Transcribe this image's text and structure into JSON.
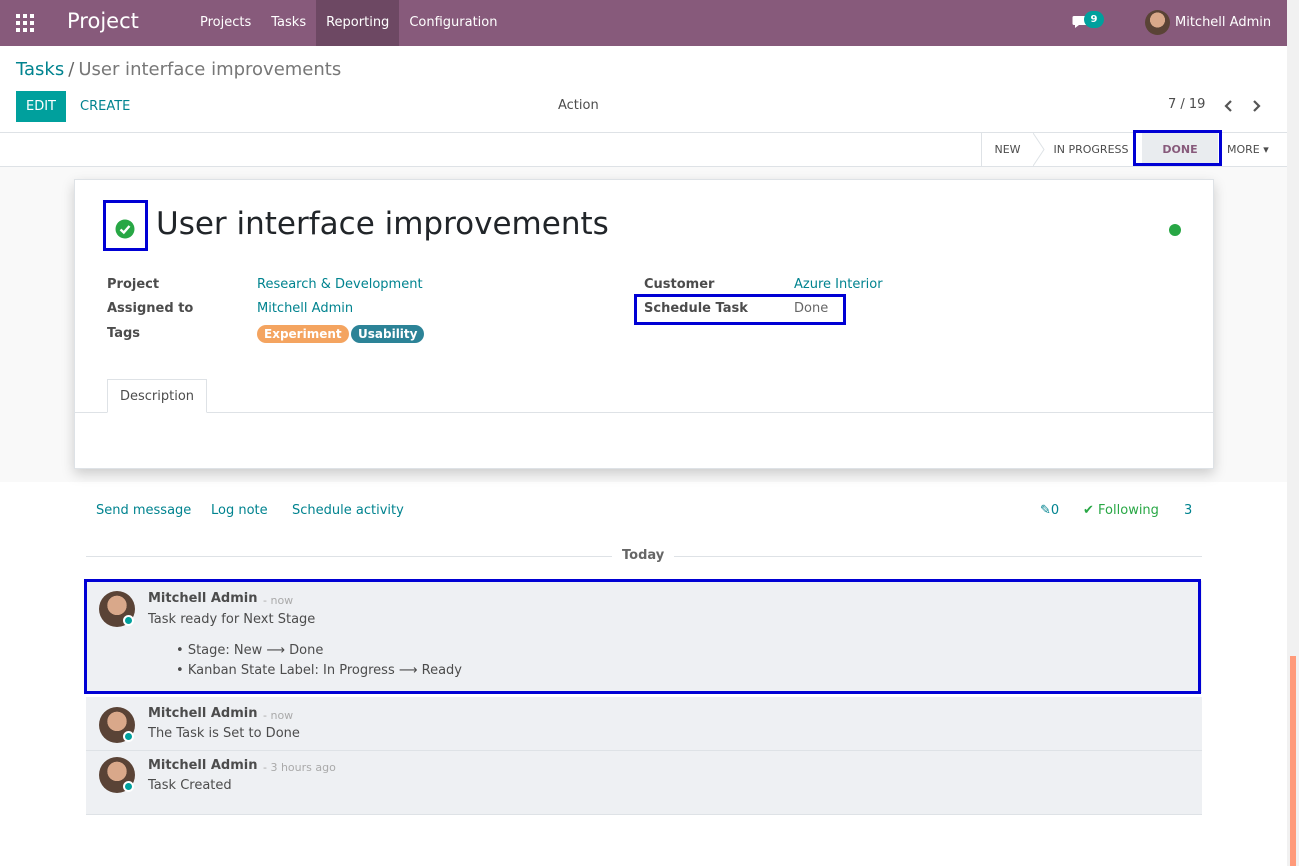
{
  "navbar": {
    "app_name": "Project",
    "menu": [
      "Projects",
      "Tasks",
      "Reporting",
      "Configuration"
    ],
    "active_menu": "Reporting",
    "messages_count": "9",
    "user_name": "Mitchell Admin",
    "color": "#875a7b"
  },
  "breadcrumb": {
    "parent": "Tasks",
    "current": "User interface improvements"
  },
  "buttons": {
    "edit": "EDIT",
    "create": "CREATE",
    "action": "Action"
  },
  "pager": {
    "value": "7 / 19"
  },
  "stages": {
    "new": "NEW",
    "in_progress": "IN PROGRESS",
    "done": "DONE",
    "more": "MORE"
  },
  "task": {
    "title": "User interface improvements",
    "project_label": "Project",
    "project": "Research & Development",
    "assigned_label": "Assigned to",
    "assigned": "Mitchell Admin",
    "tags_label": "Tags",
    "tags": [
      "Experiment",
      "Usability"
    ],
    "customer_label": "Customer",
    "customer": "Azure Interior",
    "schedule_label": "Schedule Task",
    "schedule": "Done",
    "description_tab": "Description"
  },
  "chatter": {
    "send_message": "Send message",
    "log_note": "Log note",
    "schedule_activity": "Schedule activity",
    "attachments": "0",
    "following": "Following",
    "followers": "3",
    "today": "Today",
    "messages": [
      {
        "author": "Mitchell Admin",
        "date": "- now",
        "body": "Task ready for Next Stage",
        "tracking": [
          "Stage: New",
          "Done",
          "Kanban State Label: In Progress",
          "Ready"
        ]
      },
      {
        "author": "Mitchell Admin",
        "date": "- now",
        "body": "The Task is Set to Done"
      },
      {
        "author": "Mitchell Admin",
        "date": "- 3 hours ago",
        "body": "Task Created"
      }
    ]
  }
}
